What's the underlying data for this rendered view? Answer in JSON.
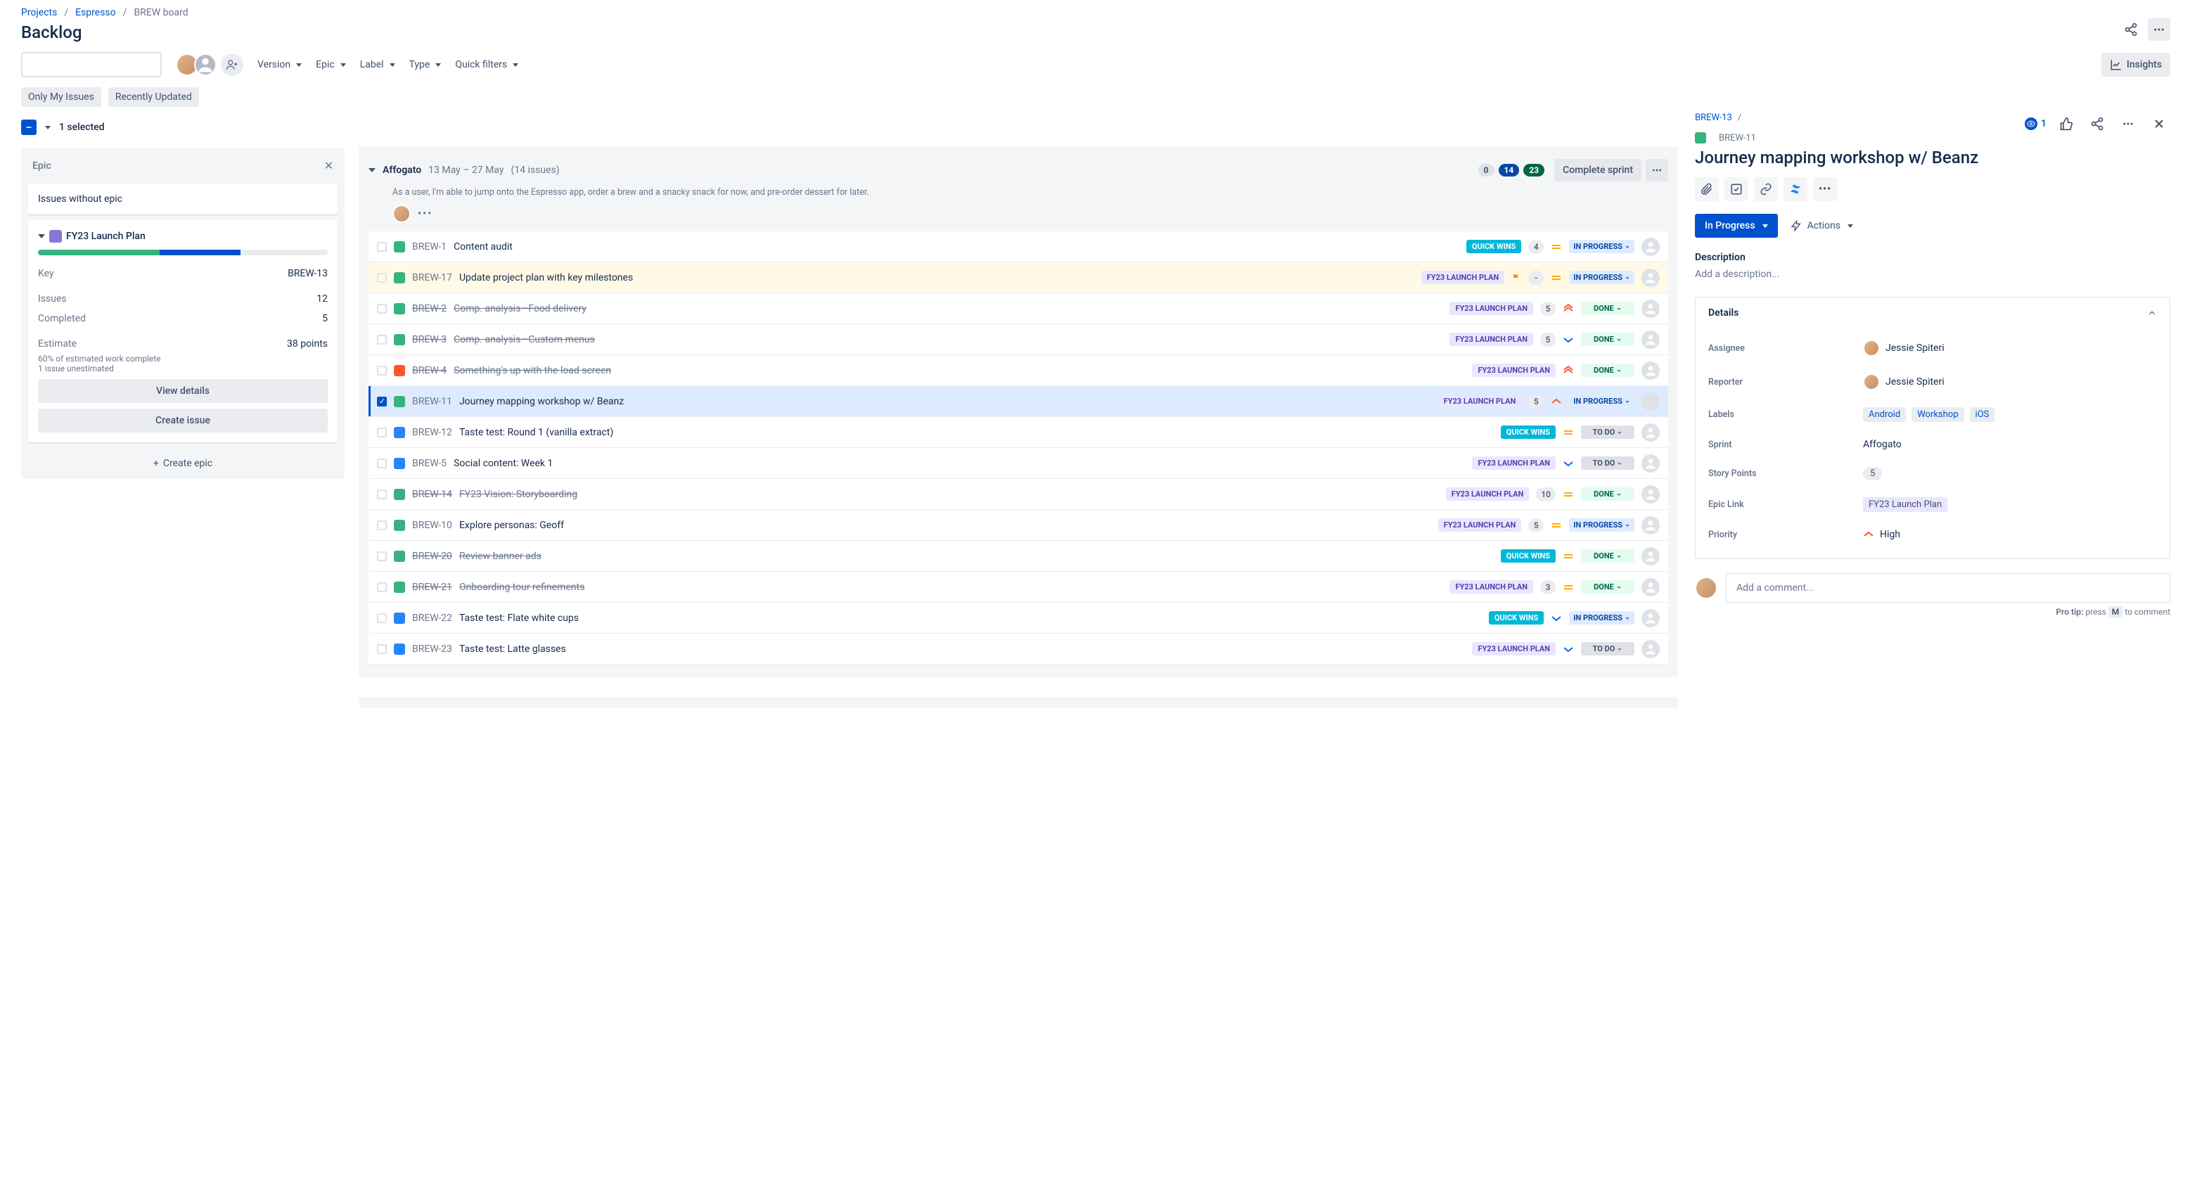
{
  "breadcrumb": {
    "projects": "Projects",
    "project": "Espresso",
    "board": "BREW board"
  },
  "page_title": "Backlog",
  "header": {
    "insights": "Insights"
  },
  "filters": {
    "version": "Version",
    "epic": "Epic",
    "label": "Label",
    "type": "Type",
    "quick": "Quick filters",
    "only_mine": "Only My Issues",
    "recent": "Recently Updated"
  },
  "selection": {
    "count": "1 selected"
  },
  "epic_panel": {
    "title": "Epic",
    "no_epic": "Issues without epic",
    "launch_title": "FY23 Launch Plan",
    "key_label": "Key",
    "key_val": "BREW-13",
    "issues_label": "Issues",
    "issues_val": "12",
    "completed_label": "Completed",
    "completed_val": "5",
    "estimate_label": "Estimate",
    "estimate_val": "38 points",
    "est_pct": "60% of estimated work complete",
    "est_un": "1 issue unestimated",
    "view_details": "View details",
    "create_issue": "Create issue",
    "create_epic": "Create epic"
  },
  "sprint": {
    "name": "Affogato",
    "dates": "13 May – 27 May",
    "count": "(14 issues)",
    "goal": "As a user, I'm able to jump onto the Espresso app, order a brew and a snacky snack for now, and pre-order dessert for later.",
    "chip_todo": "0",
    "chip_prog": "14",
    "chip_done": "23",
    "complete": "Complete sprint"
  },
  "status": {
    "todo": "TO DO",
    "prog": "IN PROGRESS",
    "done": "DONE"
  },
  "labels": {
    "quick": "QUICK WINS",
    "fy23": "FY23 LAUNCH PLAN"
  },
  "rows": [
    {
      "key": "BREW-1",
      "title": "Content audit",
      "type": "story",
      "label": "quick",
      "est": "4",
      "prio": "med",
      "status": "prog"
    },
    {
      "key": "BREW-17",
      "title": "Update project plan with key milestones",
      "type": "story",
      "label": "fy23",
      "flag": true,
      "est": "-",
      "prio": "med",
      "status": "prog",
      "hl": true
    },
    {
      "key": "BREW-2",
      "title": "Comp. analysis—Food delivery",
      "type": "story",
      "label": "fy23",
      "est": "5",
      "prio": "highest",
      "status": "done",
      "done": true
    },
    {
      "key": "BREW-3",
      "title": "Comp. analysis—Custom menus",
      "type": "story",
      "label": "fy23",
      "est": "5",
      "prio": "low",
      "status": "done",
      "done": true
    },
    {
      "key": "BREW-4",
      "title": "Something's up with the load screen",
      "type": "bug",
      "label": "fy23",
      "prio": "highest",
      "status": "done",
      "done": true
    },
    {
      "key": "BREW-11",
      "title": "Journey mapping workshop w/ Beanz",
      "type": "story",
      "label": "fy23",
      "est": "5",
      "prio": "high",
      "status": "prog",
      "sel": true,
      "asgn": "photo"
    },
    {
      "key": "BREW-12",
      "title": "Taste test: Round 1 (vanilla extract)",
      "type": "task",
      "label": "quick",
      "prio": "med",
      "status": "todo"
    },
    {
      "key": "BREW-5",
      "title": "Social content: Week 1",
      "type": "task",
      "label": "fy23",
      "prio": "low",
      "status": "todo"
    },
    {
      "key": "BREW-14",
      "title": "FY23 Vision: Storyboarding",
      "type": "story",
      "label": "fy23",
      "est": "10",
      "prio": "med",
      "status": "done",
      "done": true
    },
    {
      "key": "BREW-10",
      "title": "Explore personas: Geoff",
      "type": "story",
      "label": "fy23",
      "est": "5",
      "prio": "med",
      "status": "prog"
    },
    {
      "key": "BREW-20",
      "title": "Review banner ads",
      "type": "story",
      "label": "quick",
      "prio": "med",
      "status": "done",
      "done": true
    },
    {
      "key": "BREW-21",
      "title": "Onboarding tour refinements",
      "type": "story",
      "label": "fy23",
      "est": "3",
      "prio": "med",
      "status": "done",
      "done": true
    },
    {
      "key": "BREW-22",
      "title": "Taste test: Flate white cups",
      "type": "task",
      "label": "quick",
      "prio": "low",
      "status": "prog"
    },
    {
      "key": "BREW-23",
      "title": "Taste test: Latte glasses",
      "type": "task",
      "label": "fy23",
      "prio": "low",
      "status": "todo"
    }
  ],
  "detail": {
    "parent": "BREW-13",
    "key": "BREW-11",
    "watch": "1",
    "title": "Journey mapping workshop w/ Beanz",
    "status": "In Progress",
    "actions": "Actions",
    "desc": "Description",
    "desc_ph": "Add a description...",
    "details": "Details",
    "assignee_k": "Assignee",
    "assignee_v": "Jessie Spiteri",
    "reporter_k": "Reporter",
    "reporter_v": "Jessie Spiteri",
    "labels_k": "Labels",
    "labels_v": [
      "Android",
      "Workshop",
      "iOS"
    ],
    "sprint_k": "Sprint",
    "sprint_v": "Affogato",
    "sp_k": "Story Points",
    "sp_v": "5",
    "epic_k": "Epic Link",
    "epic_v": "FY23 Launch Plan",
    "prio_k": "Priority",
    "prio_v": "High",
    "comment_ph": "Add a comment...",
    "protip_pre": "Pro tip: ",
    "protip_press": "press ",
    "protip_key": "M",
    "protip_post": " to comment"
  }
}
